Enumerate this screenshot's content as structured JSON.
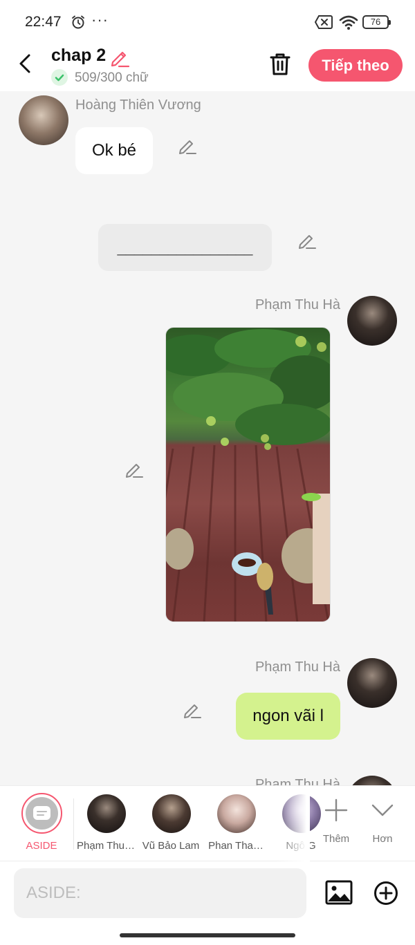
{
  "status_bar": {
    "time": "22:47",
    "more": "···",
    "battery": "76"
  },
  "header": {
    "title": "chap 2",
    "word_count": "509/300 chữ",
    "next_label": "Tiếp theo"
  },
  "colors": {
    "accent": "#f5566f",
    "green_bubble": "#d4f28e",
    "check_green": "#3cc26b"
  },
  "messages": [
    {
      "sender": "Hoàng Thiên Vương",
      "text": "Ok bé",
      "side": "left"
    },
    {
      "type": "aside",
      "text": "________________"
    },
    {
      "sender": "Phạm Thu Hà",
      "type": "image",
      "side": "right"
    },
    {
      "sender": "Phạm Thu Hà",
      "text": "ngon vãi l",
      "side": "right"
    },
    {
      "sender": "Phạm Thu Hà",
      "side": "right",
      "partial": true
    }
  ],
  "characters": {
    "aside_label": "ASIDE",
    "items": [
      {
        "name": "Phạm Thu…"
      },
      {
        "name": "Vũ Bảo Lam"
      },
      {
        "name": "Phan Tha…"
      },
      {
        "name": "Ngô G"
      }
    ],
    "add_label": "Thêm",
    "more_label": "Hơn"
  },
  "input": {
    "placeholder": "ASIDE:"
  }
}
